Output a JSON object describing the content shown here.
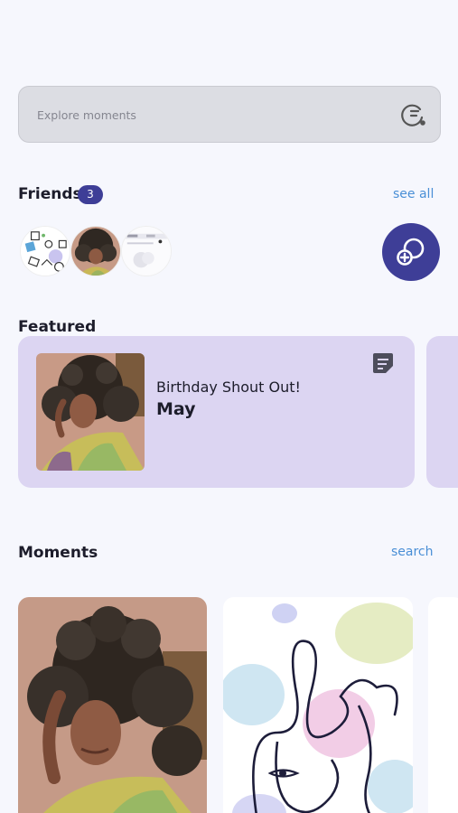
{
  "search": {
    "placeholder": "Explore moments",
    "icon": "search-refresh-icon"
  },
  "friends": {
    "title": "Friends",
    "count": "3",
    "see_all": "see all",
    "avatars": [
      "avatar-doodle",
      "avatar-portrait",
      "avatar-screenshot"
    ],
    "add_icon": "add-friend-icon"
  },
  "featured": {
    "title": "Featured",
    "card": {
      "title": "Birthday Shout Out!",
      "name": "May",
      "icon": "note-icon"
    }
  },
  "moments": {
    "title": "Moments",
    "search": "search"
  },
  "colors": {
    "accent": "#3e3e97",
    "link": "#4a8fd6",
    "card": "#dcd5f2",
    "background": "#f6f7fd"
  }
}
